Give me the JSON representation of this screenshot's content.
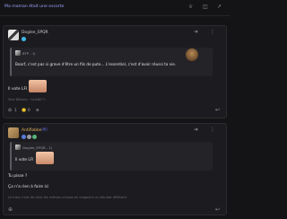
{
  "topbar": {
    "title": "Ma maman était une escorte",
    "icons": [
      "crown-icon",
      "stack-icon",
      "share-icon"
    ]
  },
  "post1": {
    "author": "Doglee_SPQR",
    "quote": {
      "author": "BTP - 1j",
      "text": "Boarf, c'est pas si grave d'être un fils de pute... L'essentiel, c'est d'avoir réussi ta vie."
    },
    "body": "Il vote LFI",
    "signature": "Vive Bébora · GLAND ✎",
    "reactions": {
      "count_a": "1",
      "count_b": "0"
    }
  },
  "post2": {
    "author": "Antiflobber",
    "tag": "✓",
    "quote": {
      "author": "Doglee_SPQR - 1j",
      "text": "Il vote LFI"
    },
    "body_line1": "Tu pisse ?",
    "body_line2": "Ça n'a rien à faire ici",
    "signature": "Le futur c'est de faire les mêmes choses en exigeant un résultat différent"
  }
}
